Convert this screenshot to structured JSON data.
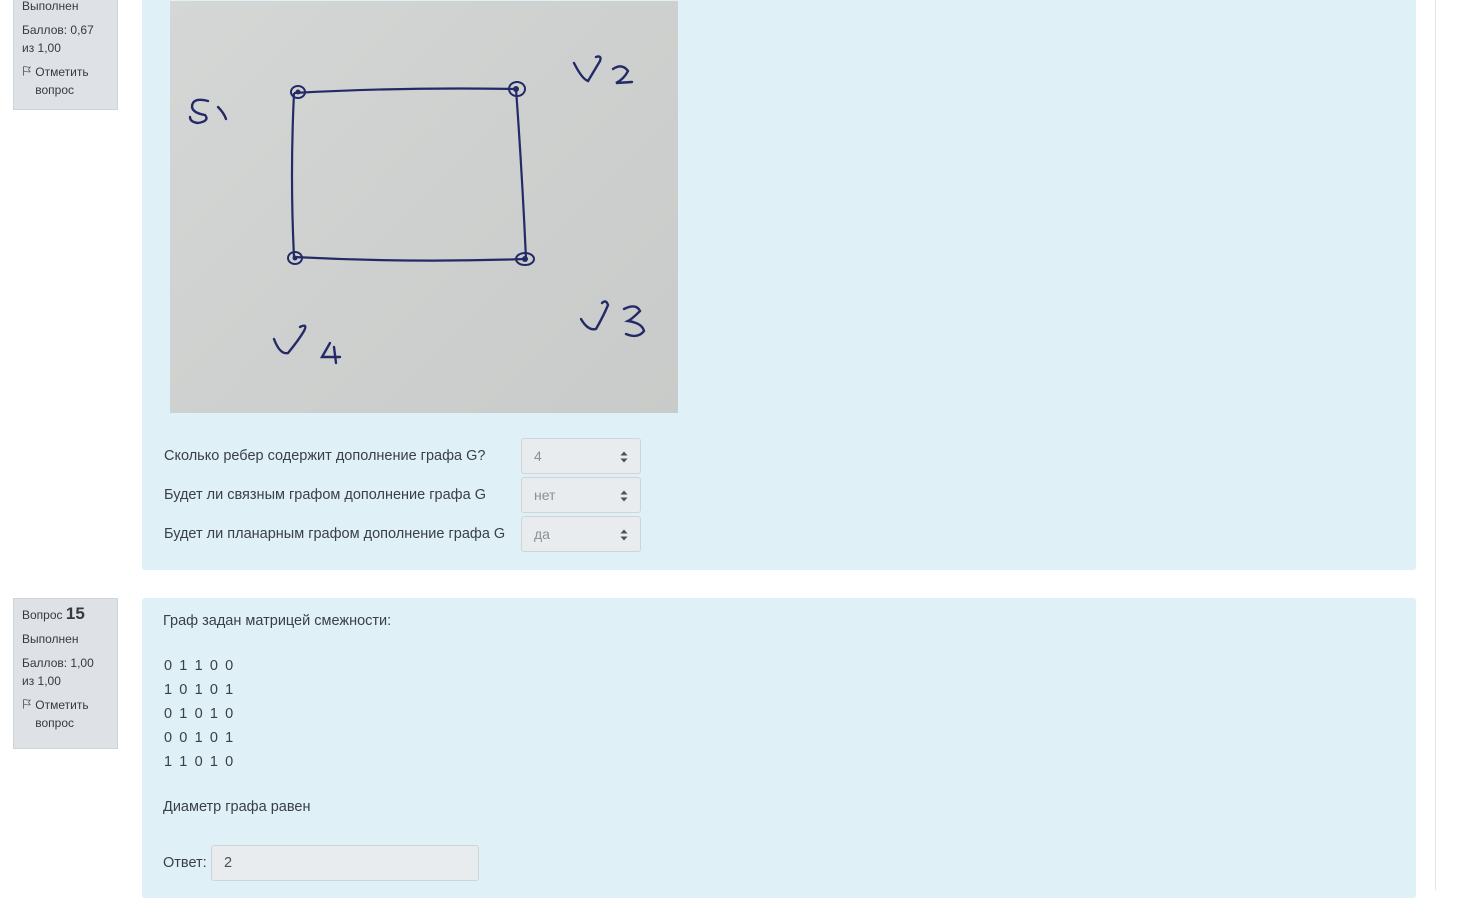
{
  "q14": {
    "status": "Выполнен",
    "score": "Баллов: 0,67 из 1,00",
    "flag_label": "Отметить вопрос",
    "photo": {
      "vertex_labels": [
        "v1",
        "v2",
        "v3",
        "v4"
      ]
    },
    "rows": [
      {
        "label": "Сколько ребер содержит дополнение графа G?",
        "value": "4"
      },
      {
        "label": "Будет ли связным графом дополнение графа G",
        "value": "нет"
      },
      {
        "label": "Будет ли планарным графом дополнение графа G",
        "value": "да"
      }
    ]
  },
  "q15": {
    "label": "Вопрос",
    "number": "15",
    "status": "Выполнен",
    "score": "Баллов: 1,00 из 1,00",
    "flag_label": "Отметить вопрос",
    "intro": "Граф задан матрицей смежности:",
    "matrix": [
      "0 1 1 0 0",
      "1 0 1 0 1",
      "0 1 0 1 0",
      "0 0 1 0 1",
      "1 1 0 1 0"
    ],
    "question": "Диаметр графа равен",
    "answer_label": "Ответ:",
    "answer_value": "2"
  }
}
